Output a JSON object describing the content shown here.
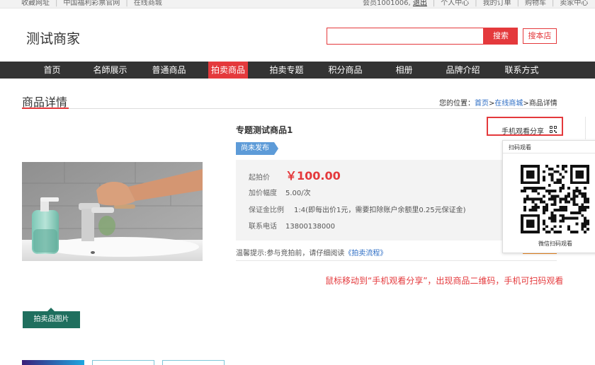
{
  "topbar": {
    "left": [
      "收藏网址",
      "中国福利彩票官网",
      "在线商城"
    ],
    "user": "会员1001006",
    "logout": "退出",
    "links": [
      "个人中心",
      "我的订单",
      "购物车",
      "卖家中心"
    ]
  },
  "header": {
    "shop_name": "测试商家",
    "search_value": "",
    "search_button": "搜索",
    "store_button": "搜本店"
  },
  "nav": {
    "items": [
      "首页",
      "名師展示",
      "普通商品",
      "拍卖商品",
      "拍卖专题",
      "积分商品",
      "相册",
      "品牌介绍",
      "联系方式"
    ],
    "active_index": 3
  },
  "section": {
    "title": "商品详情",
    "breadcrumb_prefix": "您的位置：",
    "crumb_home": "首页",
    "crumb_sep": ">",
    "crumb_mall": "在线商城",
    "crumb_current": "商品详情"
  },
  "product": {
    "title": "专题测试商品1",
    "status": "尚未发布",
    "start_price_label": "起拍价",
    "start_price": "￥100.00",
    "increment_label": "加价幅度",
    "increment": "5.00/次",
    "deposit_label": "保证金比例",
    "deposit": "1:4(即每出价1元，需要扣除账户余额里0.25元保证金)",
    "phone_label": "联系电话",
    "phone": "13800138000",
    "tip_prefix": "温馨提示:参与竞拍前，请仔细阅读",
    "tip_link": "《拍卖流程》",
    "image_tag": "拍卖品图片"
  },
  "share": {
    "label": "手机观看分享",
    "popup_title": "扫码观看",
    "popup_caption": "微信扫码观看"
  },
  "annotation": "鼠标移动到“手机观看分享”，出现商品二维码，手机可扫码观看",
  "colors": {
    "accent": "#e4393c",
    "nav_bg": "#333333",
    "status_tag": "#5d9bd8",
    "image_tag": "#1f6f5e"
  }
}
